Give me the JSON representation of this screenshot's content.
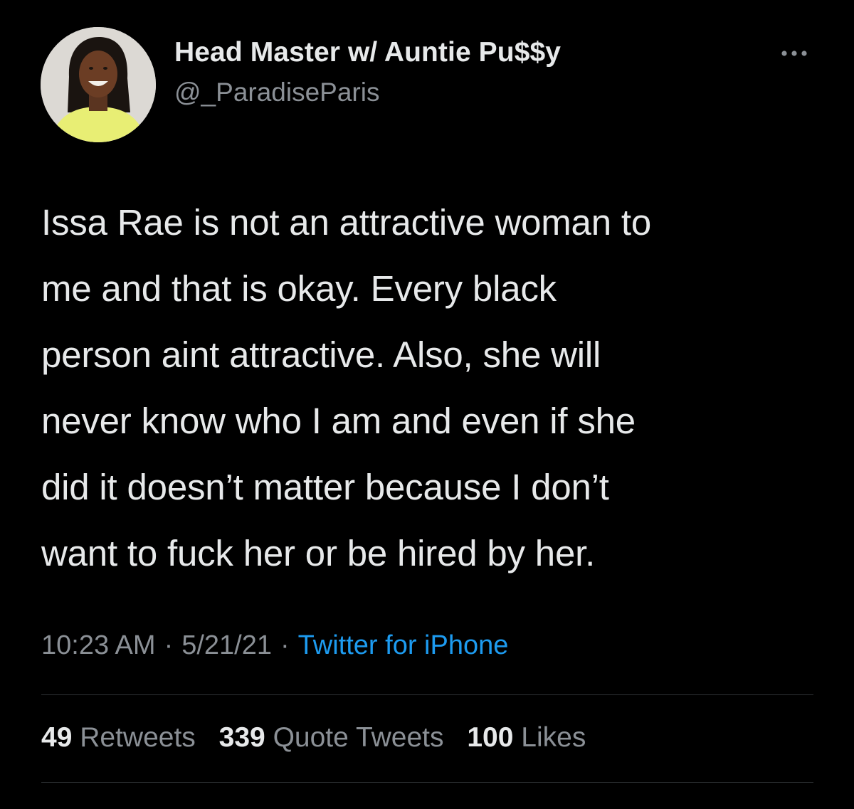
{
  "author": {
    "display_name": "Head Master w/ Auntie Pu$$y",
    "handle": "@_ParadiseParis",
    "avatar_icon": "profile-photo"
  },
  "more_icon": "more-horizontal-icon",
  "tweet": {
    "text": "Issa Rae is not an attractive woman to\nme and that is okay. Every black\nperson aint attractive. Also, she will\nnever know who I am and even if she\ndid it doesn’t matter because I don’t\nwant to fuck her or be hired by her."
  },
  "meta": {
    "time": "10:23 AM",
    "separator": "·",
    "date": "5/21/21",
    "source": "Twitter for iPhone"
  },
  "stats": {
    "retweets": {
      "count": "49",
      "label": "Retweets"
    },
    "quotes": {
      "count": "339",
      "label": "Quote Tweets"
    },
    "likes": {
      "count": "100",
      "label": "Likes"
    }
  },
  "colors": {
    "background": "#000000",
    "text": "#e7e9ea",
    "secondary": "#8b9096",
    "link": "#1d9bf0",
    "divider": "#2f3336"
  }
}
